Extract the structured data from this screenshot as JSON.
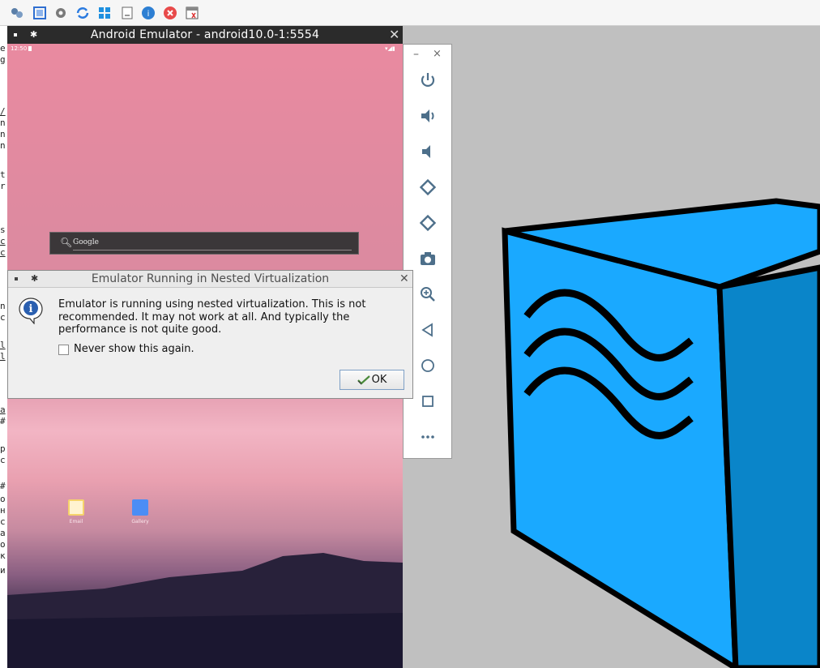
{
  "taskbar": {
    "icons": [
      "settings-cubes-icon",
      "fullscreen-icon",
      "gear-icon",
      "refresh-icon",
      "windows-icon",
      "document-icon",
      "info-icon",
      "close-icon",
      "calendar-icon"
    ]
  },
  "background_text": {
    "lines": [
      "e",
      "g",
      "/",
      "n",
      "n",
      "n",
      "t",
      "r",
      "s",
      "c",
      "c",
      "n",
      "c",
      "l",
      "l",
      "a",
      "#",
      "p",
      "c",
      "#",
      "o",
      "н",
      "c",
      "a",
      "o",
      "к",
      "и"
    ]
  },
  "emulator": {
    "title": "Android Emulator - android10.0-1:5554",
    "status_time": "12:50",
    "search_placeholder": "Google",
    "apps": [
      {
        "label": "Email",
        "color": "#f6d36b"
      },
      {
        "label": "Gallery",
        "color": "#4c8df5"
      }
    ]
  },
  "side_toolbar": {
    "minimize": "–",
    "close": "×",
    "buttons": [
      "power-icon",
      "volume-up-icon",
      "volume-down-icon",
      "rotate-left-icon",
      "rotate-right-icon",
      "camera-icon",
      "zoom-icon",
      "back-icon",
      "home-icon",
      "overview-icon",
      "more-icon"
    ]
  },
  "dialog": {
    "title": "Emulator Running in Nested Virtualization",
    "message": "Emulator is running using nested virtualization. This is not recommended. It may not work at all. And typically the performance is not quite good.",
    "checkbox_label": "Never show this again.",
    "checkbox_checked": false,
    "ok_label": "OK"
  },
  "colors": {
    "cube_front": "#1aa9ff",
    "cube_side": "#0a85c9",
    "accent_blue": "#1e88e5"
  }
}
